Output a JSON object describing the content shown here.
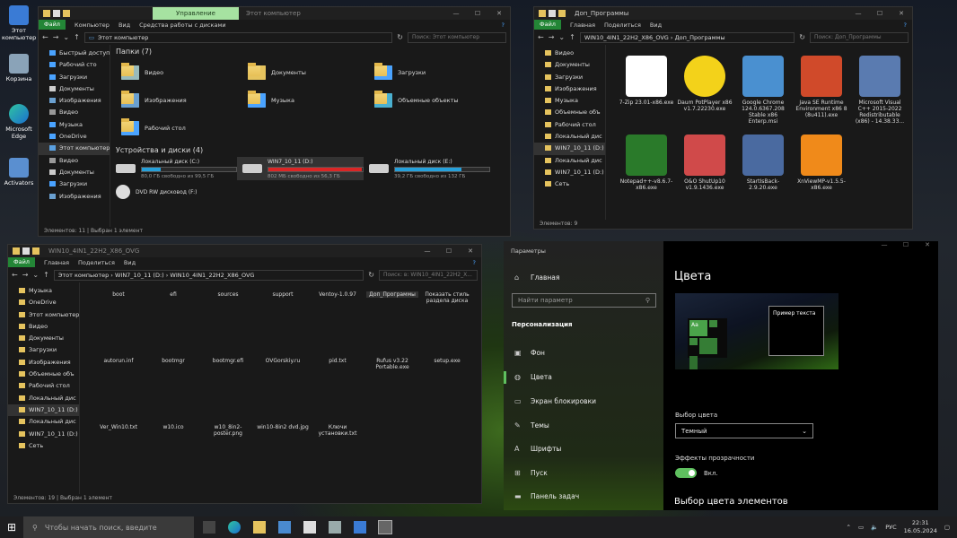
{
  "desktop": {
    "icons": [
      {
        "label": "Этот компьютер"
      },
      {
        "label": "Корзина"
      },
      {
        "label": "Microsoft Edge"
      },
      {
        "label": "Activators"
      }
    ]
  },
  "w1": {
    "tabs": {
      "ctx": "Управление",
      "title": "Этот компьютер"
    },
    "ribbon": {
      "file": "Файл",
      "items": [
        "Компьютер",
        "Вид",
        "Средства работы с дисками"
      ]
    },
    "path": "Этот компьютер",
    "search": "Поиск: Этот компьютер",
    "nav": [
      "Быстрый доступ",
      "Рабочий сто",
      "Загрузки",
      "Документы",
      "Изображения",
      "Видео",
      "Музыка",
      "OneDrive",
      "Этот компьютер",
      "Видео",
      "Документы",
      "Загрузки",
      "Изображения"
    ],
    "folders_header": "Папки (7)",
    "folders": [
      "Видео",
      "Документы",
      "Загрузки",
      "Изображения",
      "Музыка",
      "Объемные объекты",
      "Рабочий стол"
    ],
    "drives_header": "Устройства и диски (4)",
    "drives": [
      {
        "name": "Локальный диск (C:)",
        "free": "80,0 ГБ свободно из 99,5 ГБ",
        "fill": 0.2,
        "color": "#26a0da"
      },
      {
        "name": "WIN7_10_11 (D:)",
        "free": "802 МБ свободно из 56,3 ГБ",
        "fill": 0.99,
        "color": "#da2626"
      },
      {
        "name": "Локальный диск (E:)",
        "free": "39,2 ГБ свободно из 132 ГБ",
        "fill": 0.7,
        "color": "#26a0da"
      }
    ],
    "dvd": "DVD RW дисковод (F:)",
    "status": "Элементов: 11   |   Выбран 1 элемент"
  },
  "w2": {
    "title": "Доп_Программы",
    "ribbon": {
      "file": "Файл",
      "items": [
        "Главная",
        "Поделиться",
        "Вид"
      ]
    },
    "path": "WIN10_4IN1_22H2_X86_OVG  ›  Доп_Программы",
    "search": "Поиск: Доп_Программы",
    "nav": [
      "Видео",
      "Документы",
      "Загрузки",
      "Изображения",
      "Музыка",
      "Объемные объ",
      "Рабочий стол",
      "Локальный дис",
      "WIN7_10_11 (D:)",
      "Локальный дис",
      "WIN7_10_11 (D:)",
      "Сеть"
    ],
    "files": [
      "7-Zip 23.01-x86.exe",
      "Daum PotPlayer x86 v1.7.22230.exe",
      "Google Chrome 124.0.6367.208 Stable x86 Enterp.msi",
      "Java SE Runtime Environment x86 8 (8u411).exe",
      "Microsoft Visual C++ 2015-2022 Redistributable (x86) - 14.38.33...",
      "Notepad++-v8.6.7-x86.exe",
      "O&O ShutUp10 v1.9.1436.exe",
      "StartIsBack-2.9.20.exe",
      "XnViewMP-v1.5.5-x86.exe"
    ],
    "status": "Элементов: 9"
  },
  "w3": {
    "title": "WIN10_4IN1_22H2_X86_OVG",
    "ribbon": {
      "file": "Файл",
      "items": [
        "Главная",
        "Поделиться",
        "Вид"
      ]
    },
    "path": "Этот компьютер  ›  WIN7_10_11 (D:)  ›  WIN10_4IN1_22H2_X86_OVG",
    "search": "Поиск: в: WIN10_4IN1_22H2_X...",
    "nav": [
      "Музыка",
      "OneDrive",
      "Этот компьютер",
      "Видео",
      "Документы",
      "Загрузки",
      "Изображения",
      "Объемные объ",
      "Рабочий стол",
      "Локальный дис",
      "WIN7_10_11 (D:)",
      "Локальный дис",
      "WIN7_10_11 (D:)",
      "Сеть"
    ],
    "files": [
      "boot",
      "efi",
      "sources",
      "support",
      "Ventoy-1.0.97",
      "Доп_Программы",
      "Показать стиль раздела диска",
      "autorun.inf",
      "bootmgr",
      "bootmgr.efi",
      "OVGorskiy.ru",
      "pid.txt",
      "Rufus v3.22 Portable.exe",
      "setup.exe",
      "Ver_Win10.txt",
      "w10.ico",
      "w10_8in2-poster.png",
      "win10-8in2 dvd.jpg",
      "Ключи установки.txt"
    ],
    "status": "Элементов: 19   |   Выбран 1 элемент"
  },
  "settings": {
    "title": "Параметры",
    "home": "Главная",
    "search_placeholder": "Найти параметр",
    "section": "Персонализация",
    "menu": [
      "Фон",
      "Цвета",
      "Экран блокировки",
      "Темы",
      "Шрифты",
      "Пуск",
      "Панель задач"
    ],
    "heading": "Цвета",
    "preview_text": "Пример текста",
    "preview_tile": "Aa",
    "color_label": "Выбор цвета",
    "color_value": "Темный",
    "transparency_label": "Эффекты прозрачности",
    "transparency_value": "Вкл.",
    "accent_heading": "Выбор цвета элементов"
  },
  "taskbar": {
    "search": "Чтобы начать поиск, введите",
    "lang": "РУС",
    "time": "22:31",
    "date": "16.05.2024"
  },
  "colors": {
    "accent": "#238636",
    "ribbon_ctx": "#a6e2a1",
    "folder": "#e5c35e",
    "toggle": "#5fc05f"
  }
}
